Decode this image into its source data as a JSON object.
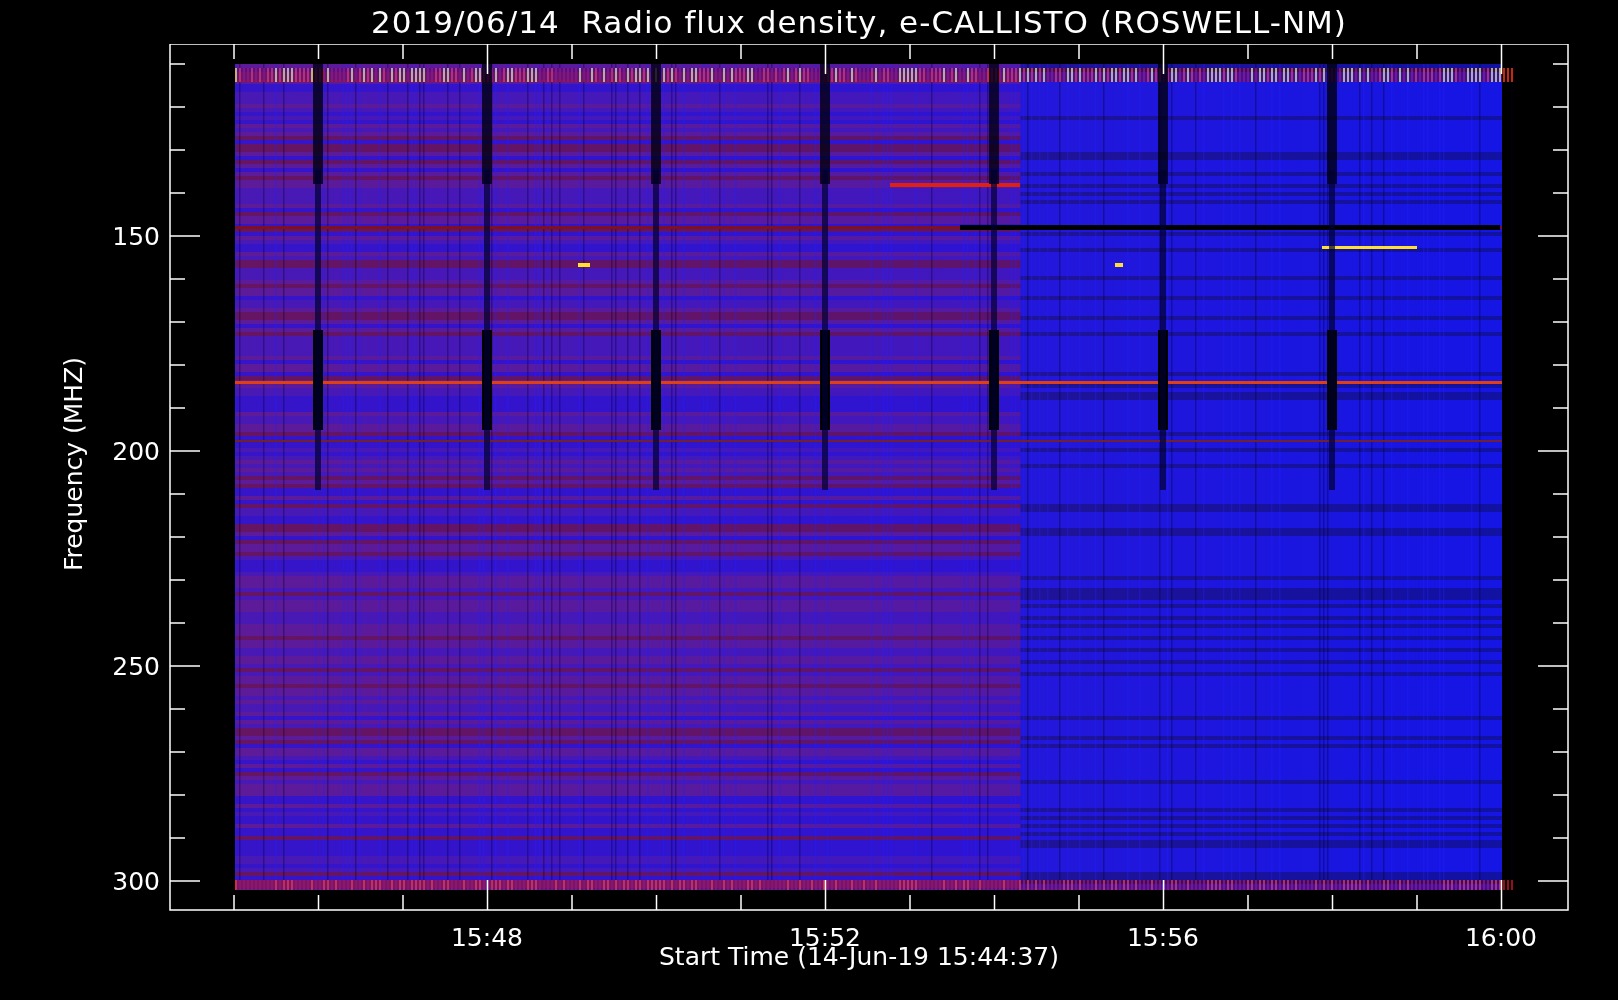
{
  "title": "2019/06/14  Radio flux density, e-CALLISTO (ROSWELL-NM)",
  "y_axis": {
    "label": "Frequency (MHZ)",
    "ticks": [
      "150",
      "200",
      "250",
      "300"
    ]
  },
  "x_axis": {
    "label": "Start Time (14-Jun-19 15:44:37)",
    "ticks": [
      "15:48",
      "15:52",
      "15:56",
      "16:00"
    ]
  }
}
